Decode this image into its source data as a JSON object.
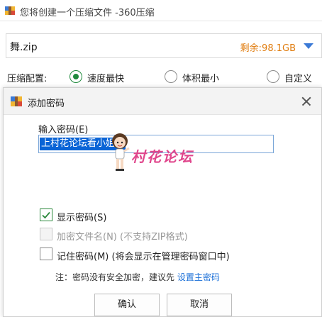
{
  "window": {
    "title": "您将创建一个压缩文件 -360压缩"
  },
  "file": {
    "name": "舞.zip",
    "free_space": "剩余:98.1GB"
  },
  "compression": {
    "label": "压缩配置:",
    "options": [
      {
        "label": "速度最快",
        "selected": true
      },
      {
        "label": "体积最小",
        "selected": false
      },
      {
        "label": "自定义",
        "selected": false
      }
    ]
  },
  "dialog": {
    "title": "添加密码",
    "password_label": "输入密码(E)",
    "password_value": "上村花论坛看小姐姐",
    "watermark_text": "村花论坛",
    "options": {
      "show_password": {
        "label": "显示密码(S)",
        "checked": true
      },
      "encrypt_names": {
        "label": "加密文件名(N) (不支持ZIP格式)",
        "checked": false,
        "disabled": true
      },
      "remember_password": {
        "label": "记住密码(M) (将会显示在管理密码窗口中)",
        "checked": false
      }
    },
    "note": {
      "prefix": "注：密码没有安全加密，建议先 ",
      "link": "设置主密码"
    },
    "buttons": {
      "ok": "确认",
      "cancel": "取消"
    }
  },
  "colors": {
    "accent_green": "#1e8a3c",
    "link_blue": "#1a6fd8",
    "free_space_orange": "#e07d10",
    "selection_blue": "#0a64d6",
    "watermark_pink": "#e0468c"
  }
}
